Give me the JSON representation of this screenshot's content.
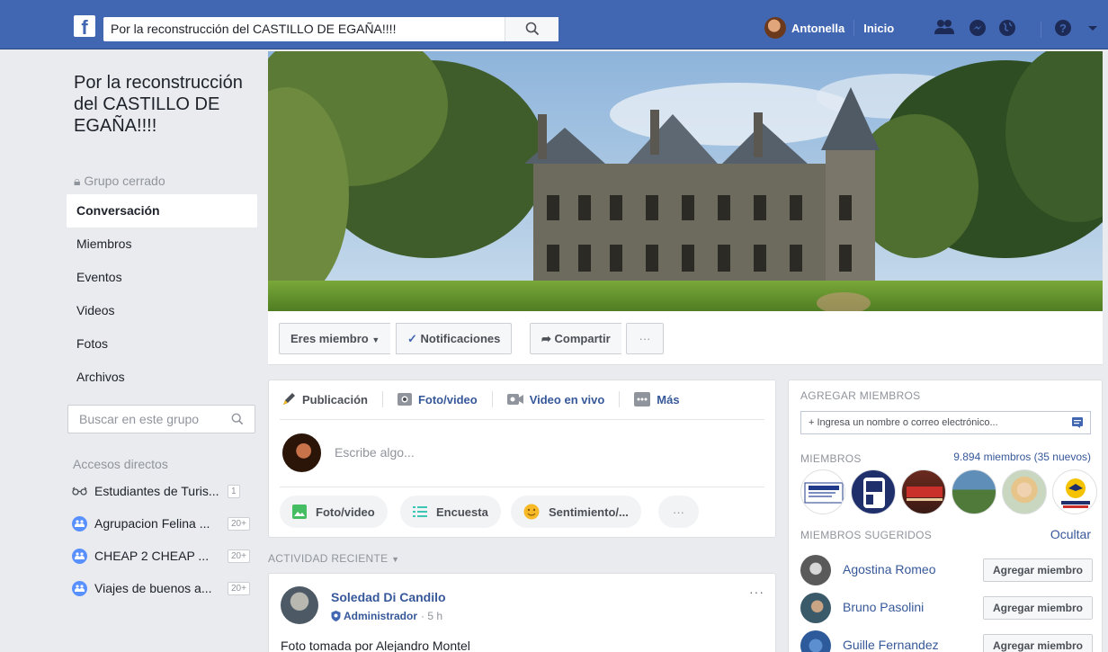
{
  "topbar": {
    "logo": "f",
    "search_value": "Por la reconstrucción del CASTILLO DE EGAÑA!!!!",
    "user_name": "Antonella",
    "home_label": "Inicio"
  },
  "group": {
    "title": "Por la reconstrucción del CASTILLO DE EGAÑA!!!!",
    "status": "Grupo cerrado"
  },
  "left_nav": [
    {
      "label": "Conversación"
    },
    {
      "label": "Miembros"
    },
    {
      "label": "Eventos"
    },
    {
      "label": "Videos"
    },
    {
      "label": "Fotos"
    },
    {
      "label": "Archivos"
    }
  ],
  "group_search": {
    "placeholder": "Buscar en este grupo"
  },
  "shortcuts": {
    "heading": "Accesos directos",
    "items": [
      {
        "label": "Estudiantes de Turis...",
        "count": "1",
        "icon": "glasses-icon"
      },
      {
        "label": "Agrupacion Felina ...",
        "count": "20+",
        "icon": "group-icon"
      },
      {
        "label": "CHEAP 2 CHEAP ...",
        "count": "20+",
        "icon": "group-icon"
      },
      {
        "label": "Viajes de buenos a...",
        "count": "20+",
        "icon": "group-icon"
      }
    ]
  },
  "actions": {
    "member": "Eres miembro",
    "notifications": "Notificaciones",
    "share": "Compartir",
    "more": "···"
  },
  "composer": {
    "tabs": [
      "Publicación",
      "Foto/video",
      "Video en vivo",
      "Más"
    ],
    "placeholder": "Escribe algo...",
    "pills": [
      "Foto/video",
      "Encuesta",
      "Sentimiento/...",
      "···"
    ]
  },
  "activity_label": "ACTIVIDAD RECIENTE",
  "post": {
    "author": "Soledad Di Candilo",
    "role": "Administrador",
    "time": "· 5 h",
    "menu": "···",
    "text": "Foto tomada por Alejandro Montel"
  },
  "right_panel": {
    "add_heading": "AGREGAR MIEMBROS",
    "add_placeholder": "+ Ingresa un nombre o correo electrónico...",
    "members_heading": "MIEMBROS",
    "members_count": "9.894 miembros (35 nuevos)",
    "suggested_heading": "MIEMBROS SUGERIDOS",
    "hide_label": "Ocultar",
    "suggested": [
      {
        "name": "Agostina Romeo",
        "button": "Agregar miembro"
      },
      {
        "name": "Bruno Pasolini",
        "button": "Agregar miembro"
      },
      {
        "name": "Guille Fernandez",
        "button": "Agregar miembro"
      }
    ]
  },
  "colors": {
    "brand": "#4267b2",
    "link": "#365899",
    "background": "#e9ebee"
  }
}
